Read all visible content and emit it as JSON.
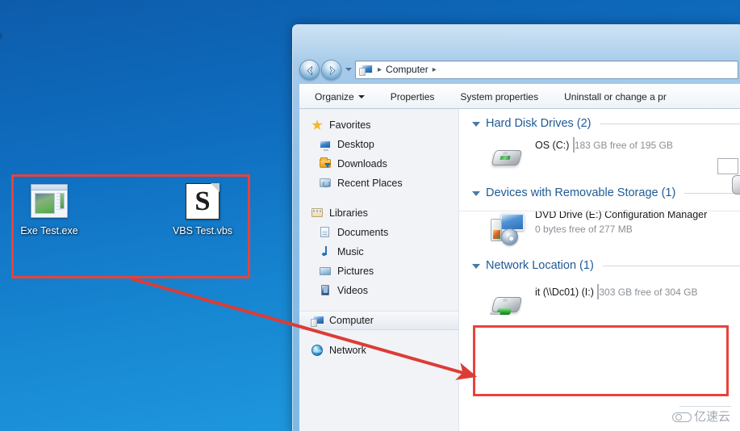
{
  "desktop": {
    "clipped_label": "n",
    "icons": [
      {
        "label": "Exe Test.exe",
        "icon": "exe-file-icon"
      },
      {
        "label": "VBS Test.vbs",
        "icon": "vbs-script-icon",
        "glyph": "S"
      }
    ]
  },
  "window": {
    "address_bar": {
      "crumb_icon": "computer-icon",
      "separator": "▸",
      "path_item": "Computer",
      "back_label": "Back",
      "forward_label": "Forward",
      "history_label": "Recent pages"
    },
    "toolbar": {
      "items": [
        {
          "label": "Organize",
          "has_caret": true
        },
        {
          "label": "Properties",
          "has_caret": false
        },
        {
          "label": "System properties",
          "has_caret": false
        },
        {
          "label": "Uninstall or change a pr",
          "has_caret": false
        }
      ]
    },
    "nav_pane": {
      "groups": [
        {
          "header": {
            "label": "Favorites",
            "icon": "star-icon"
          },
          "items": [
            {
              "label": "Desktop",
              "icon": "desktop-icon"
            },
            {
              "label": "Downloads",
              "icon": "downloads-folder-icon"
            },
            {
              "label": "Recent Places",
              "icon": "recent-places-icon"
            }
          ]
        },
        {
          "header": {
            "label": "Libraries",
            "icon": "libraries-icon"
          },
          "items": [
            {
              "label": "Documents",
              "icon": "documents-icon"
            },
            {
              "label": "Music",
              "icon": "music-icon"
            },
            {
              "label": "Pictures",
              "icon": "pictures-icon"
            },
            {
              "label": "Videos",
              "icon": "videos-icon"
            }
          ]
        }
      ],
      "computer": {
        "label": "Computer",
        "icon": "computer-icon",
        "selected": true
      },
      "network": {
        "label": "Network",
        "icon": "network-globe-icon",
        "selected": false
      }
    },
    "detail_pane": {
      "groups": [
        {
          "title": "Hard Disk Drives (2)",
          "expanded": true,
          "drives": [
            {
              "name": "OS (C:)",
              "free_text": "183 GB free of 195 GB",
              "used_percent": 6,
              "icon": "hard-disk-icon",
              "has_bar": true
            }
          ]
        },
        {
          "title": "Devices with Removable Storage (1)",
          "expanded": true,
          "drives": [
            {
              "name": "DVD Drive (E:) Configuration Manager",
              "free_text": "0 bytes free of 277 MB",
              "used_percent": 100,
              "icon": "dvd-drive-icon",
              "has_bar": false
            }
          ]
        },
        {
          "title": "Network Location (1)",
          "expanded": true,
          "drives": [
            {
              "name": "it (\\\\Dc01) (I:)",
              "free_text": "303 GB free of 304 GB",
              "used_percent": 0,
              "icon": "network-drive-icon",
              "has_bar": true
            }
          ]
        }
      ]
    }
  },
  "annotations": {
    "highlight_boxes": [
      {
        "name": "desktop-files-highlight",
        "color": "#e8423c"
      },
      {
        "name": "network-drive-highlight",
        "color": "#e8423c"
      }
    ],
    "arrow": {
      "name": "pointer-arrow",
      "color": "#dc3c36"
    }
  },
  "watermark": {
    "text": "亿速云",
    "icon": "cloud-icon"
  },
  "colors": {
    "accent": "#1f5a94",
    "annotation_red": "#e8423c",
    "bar_fill": "#2fb6d4",
    "desktop_blue": "#0f6dbf"
  }
}
